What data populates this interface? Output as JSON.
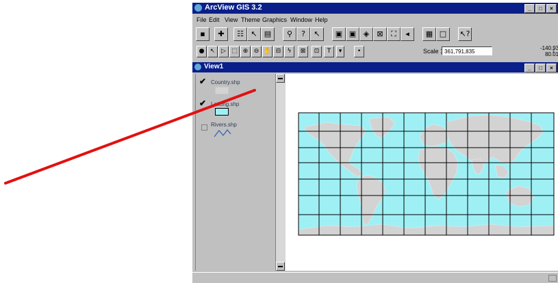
{
  "app": {
    "title": "ArcView GIS 3.2",
    "window_buttons": [
      "_",
      "□",
      "×"
    ]
  },
  "menu": [
    "File",
    "Edit",
    "View",
    "Theme",
    "Graphics",
    "Window",
    "Help"
  ],
  "toolbar": {
    "scale_label": "Scale 1:",
    "scale_value": "361,791,835",
    "coords": [
      "-140.93",
      "80.01"
    ],
    "coords_unit": "↕"
  },
  "view": {
    "title": "View1",
    "layers": [
      {
        "name": "Country.shp",
        "checked": true,
        "swatch_color": "#d3d3d3"
      },
      {
        "name": "Latlong.shp",
        "checked": true,
        "swatch_color": "#9ff0f5"
      },
      {
        "name": "Rivers.shp",
        "checked": false,
        "swatch_icon": "line-icon"
      }
    ]
  },
  "colors": {
    "title_bar": "#0a1f8a",
    "ocean": "#9ff0f5",
    "land": "#d3d3d3",
    "grid": "#000000",
    "annotation_arrow": "#e31010"
  }
}
